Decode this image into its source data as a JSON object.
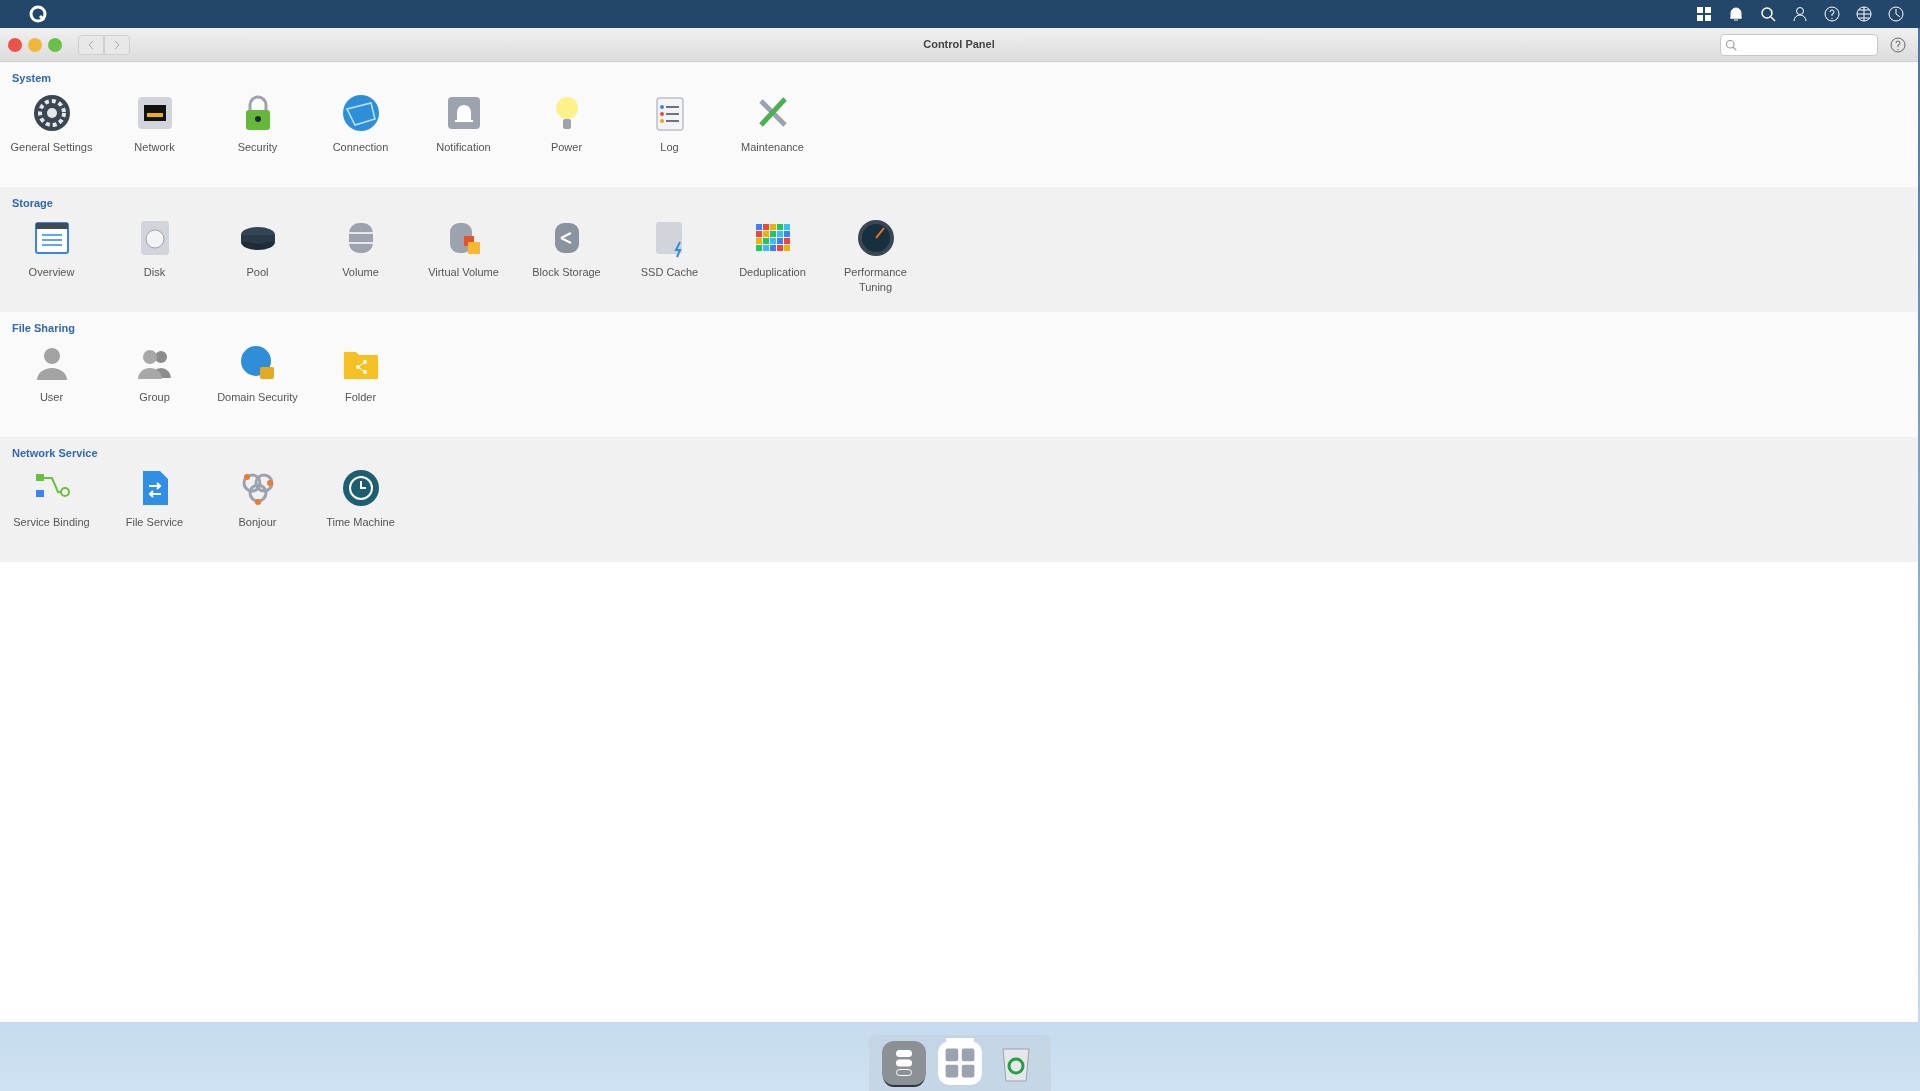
{
  "window": {
    "title": "Control Panel"
  },
  "sections": [
    {
      "title": "System",
      "items": [
        {
          "label": "General Settings"
        },
        {
          "label": "Network"
        },
        {
          "label": "Security"
        },
        {
          "label": "Connection"
        },
        {
          "label": "Notification"
        },
        {
          "label": "Power"
        },
        {
          "label": "Log"
        },
        {
          "label": "Maintenance"
        }
      ]
    },
    {
      "title": "Storage",
      "items": [
        {
          "label": "Overview"
        },
        {
          "label": "Disk"
        },
        {
          "label": "Pool"
        },
        {
          "label": "Volume"
        },
        {
          "label": "Virtual Volume"
        },
        {
          "label": "Block Storage"
        },
        {
          "label": "SSD Cache"
        },
        {
          "label": "Deduplication"
        },
        {
          "label": "Performance Tuning"
        }
      ]
    },
    {
      "title": "File Sharing",
      "items": [
        {
          "label": "User"
        },
        {
          "label": "Group"
        },
        {
          "label": "Domain Security"
        },
        {
          "label": "Folder"
        }
      ]
    },
    {
      "title": "Network Service",
      "items": [
        {
          "label": "Service Binding"
        },
        {
          "label": "File Service"
        },
        {
          "label": "Bonjour"
        },
        {
          "label": "Time Machine"
        }
      ]
    }
  ],
  "dock": [
    {
      "selected": true
    },
    {
      "selected": false
    },
    {
      "selected": false
    }
  ]
}
